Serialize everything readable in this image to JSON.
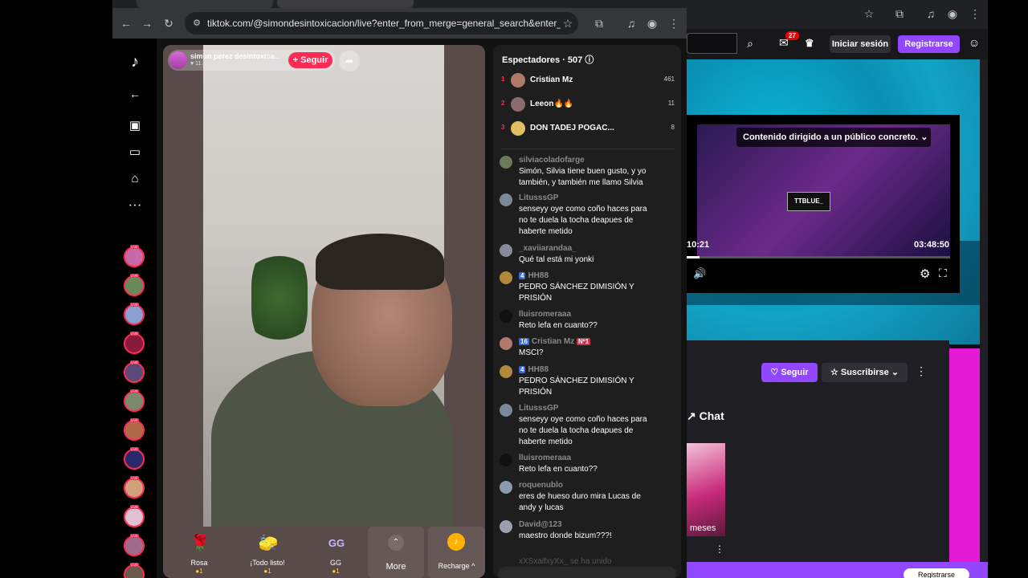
{
  "tiktok_browser": {
    "url": "tiktok.com/@simondesintoxicacion/live?enter_from_merge=general_search&enter_method=...",
    "host": {
      "name": "simon perez desintoxica...",
      "likes": "♥ 11.8K",
      "follow_label": "+ Seguir"
    },
    "gifts": [
      {
        "icon": "🌹",
        "label": "Rosa",
        "coins": "●1"
      },
      {
        "icon": "🧽",
        "label": "¡Todo listo!",
        "coins": "●1"
      },
      {
        "icon": "GG",
        "label": "GG",
        "coins": "●1"
      }
    ],
    "more_label": "More",
    "recharge_label": "Recharge ^",
    "viewers": {
      "title": "Espectadores · 507 ⓘ",
      "top": [
        {
          "rank": "1",
          "name": "Cristian Mz",
          "score": "461"
        },
        {
          "rank": "2",
          "name": "Leeon🔥🔥",
          "score": "11"
        },
        {
          "rank": "3",
          "name": "DON TADEJ POGAC...",
          "score": "8"
        }
      ]
    },
    "chat": [
      {
        "user": "silviacoladofarge",
        "badge": "",
        "badge2": "",
        "text": "Simón, Silvia tiene buen gusto, y yo también, y también me llamo Silvia"
      },
      {
        "user": "LitusssGP",
        "badge": "",
        "badge2": "",
        "text": "senseyy oye como coño haces para no te duela la tocha deapues de haberte metido"
      },
      {
        "user": "_xaviiarandaa_",
        "badge": "",
        "badge2": "",
        "text": "Qué tal está mi yonki"
      },
      {
        "user": "HH88",
        "badge": "4",
        "badge2": "",
        "text": "PEDRO SÁNCHEZ DIMISIÓN Y PRISIÓN"
      },
      {
        "user": "lluisromeraaa",
        "badge": "",
        "badge2": "",
        "text": "Reto lefa en cuanto??"
      },
      {
        "user": "Cristian Mz",
        "badge": "16",
        "badge2": "Nº1",
        "text": "MSCI?"
      },
      {
        "user": "HH88",
        "badge": "4",
        "badge2": "",
        "text": "PEDRO SÁNCHEZ DIMISIÓN Y PRISIÓN"
      },
      {
        "user": "LitusssGP",
        "badge": "",
        "badge2": "",
        "text": "senseyy oye como coño haces para no te duela la tocha deapues de haberte metido"
      },
      {
        "user": "lluisromeraaa",
        "badge": "",
        "badge2": "",
        "text": "Reto lefa en cuanto??"
      },
      {
        "user": "roquenublo",
        "badge": "",
        "badge2": "",
        "text": "eres de hueso duro mira Lucas de andy y lucas"
      },
      {
        "user": "David@123",
        "badge": "",
        "badge2": "",
        "text": "maestro donde bizum???!"
      },
      {
        "user": "xXSxalfxyXx_ se ha unido",
        "badge": "",
        "badge2": "",
        "text": ""
      }
    ]
  },
  "twitch_browser": {
    "login_label": "Iniciar sesión",
    "signup_label": "Registrarse",
    "inbox_count": "27",
    "player": {
      "warning": "Contenido dirigido a un público concreto.  ⌄",
      "brand": "TTBLUE_",
      "time_left": "10:21",
      "time_right": "03:48:50",
      "progress": 0.05
    },
    "follow_label": "♡ Seguir",
    "subscribe_label": "☆ Suscribirse ⌄",
    "chat_label": "↗ Chat",
    "card_label": "meses",
    "bottom_button": "Registrarse"
  }
}
